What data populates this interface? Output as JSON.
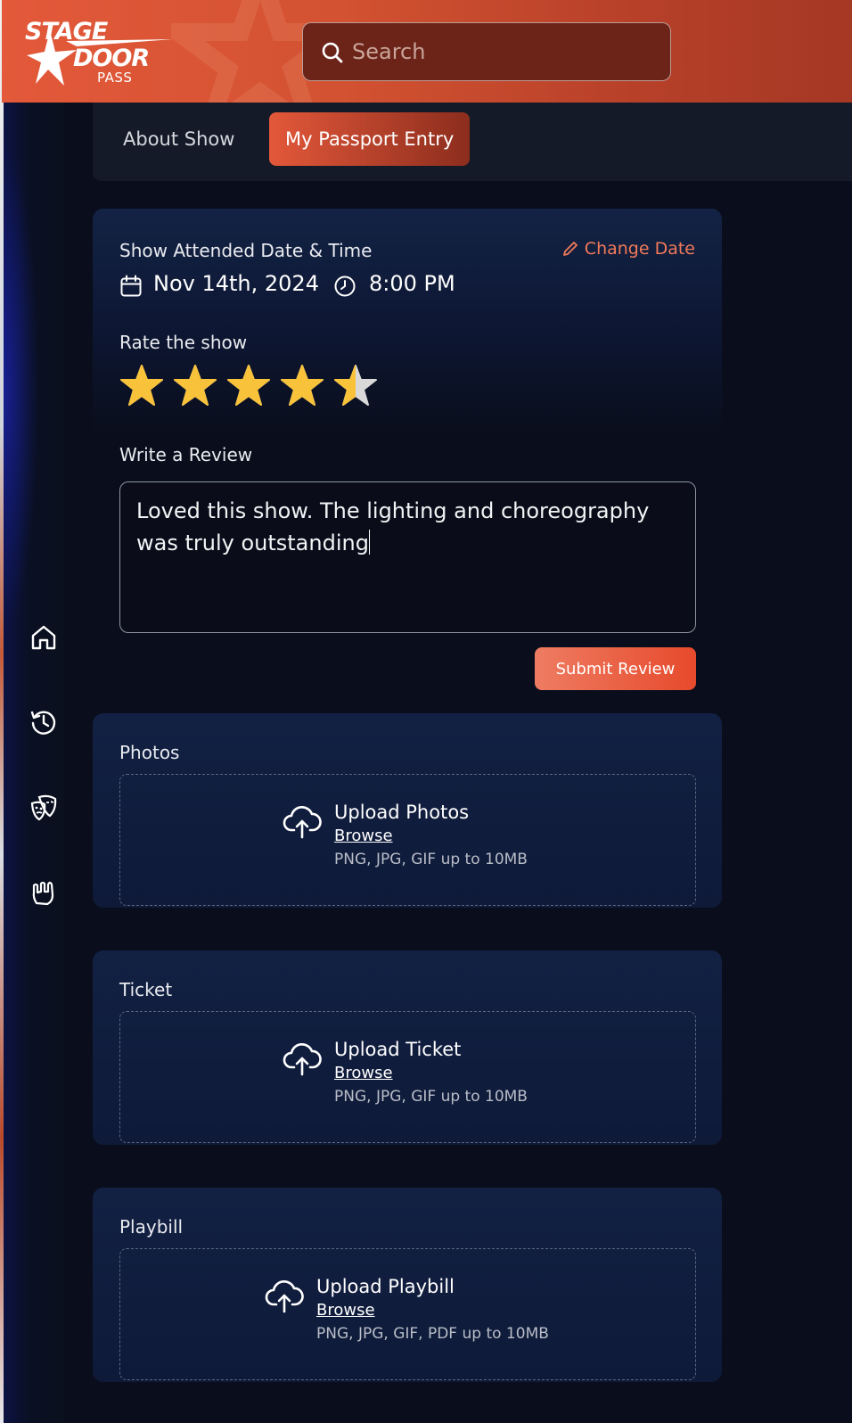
{
  "header": {
    "logo": {
      "line1": "STAGE",
      "line2": "DOOR",
      "line3": "PASS"
    },
    "search": {
      "placeholder": "Search",
      "icon": "search-icon"
    }
  },
  "sidebar": {
    "items": [
      {
        "icon": "home-icon"
      },
      {
        "icon": "history-icon"
      },
      {
        "icon": "theater-masks-icon"
      },
      {
        "icon": "rock-hand-icon"
      }
    ]
  },
  "tabs": [
    {
      "label": "About Show",
      "active": false
    },
    {
      "label": "My Passport Entry",
      "active": true
    }
  ],
  "entry": {
    "attended_label": "Show Attended Date & Time",
    "change_date_label": "Change Date",
    "date": "Nov 14th, 2024",
    "time": "8:00 PM",
    "rate_label": "Rate the show",
    "rating": 4.5,
    "rating_max": 5,
    "review_label": "Write a Review",
    "review_text": "Loved this show. The lighting and choreography was truly outstanding",
    "submit_label": "Submit Review"
  },
  "uploads": [
    {
      "section": "Photos",
      "title": "Upload Photos",
      "browse": "Browse",
      "hint": "PNG, JPG, GIF up to 10MB"
    },
    {
      "section": "Ticket",
      "title": "Upload Ticket",
      "browse": "Browse",
      "hint": "PNG, JPG, GIF up to 10MB"
    },
    {
      "section": "Playbill",
      "title": "Upload Playbill",
      "browse": "Browse",
      "hint": "PNG, JPG, GIF, PDF up to 10MB"
    }
  ],
  "colors": {
    "accent": "#e3583a",
    "link": "#f17a58",
    "star": "#f8c23a",
    "star_empty": "#d9d9d9",
    "background": "#0a0e1c"
  }
}
